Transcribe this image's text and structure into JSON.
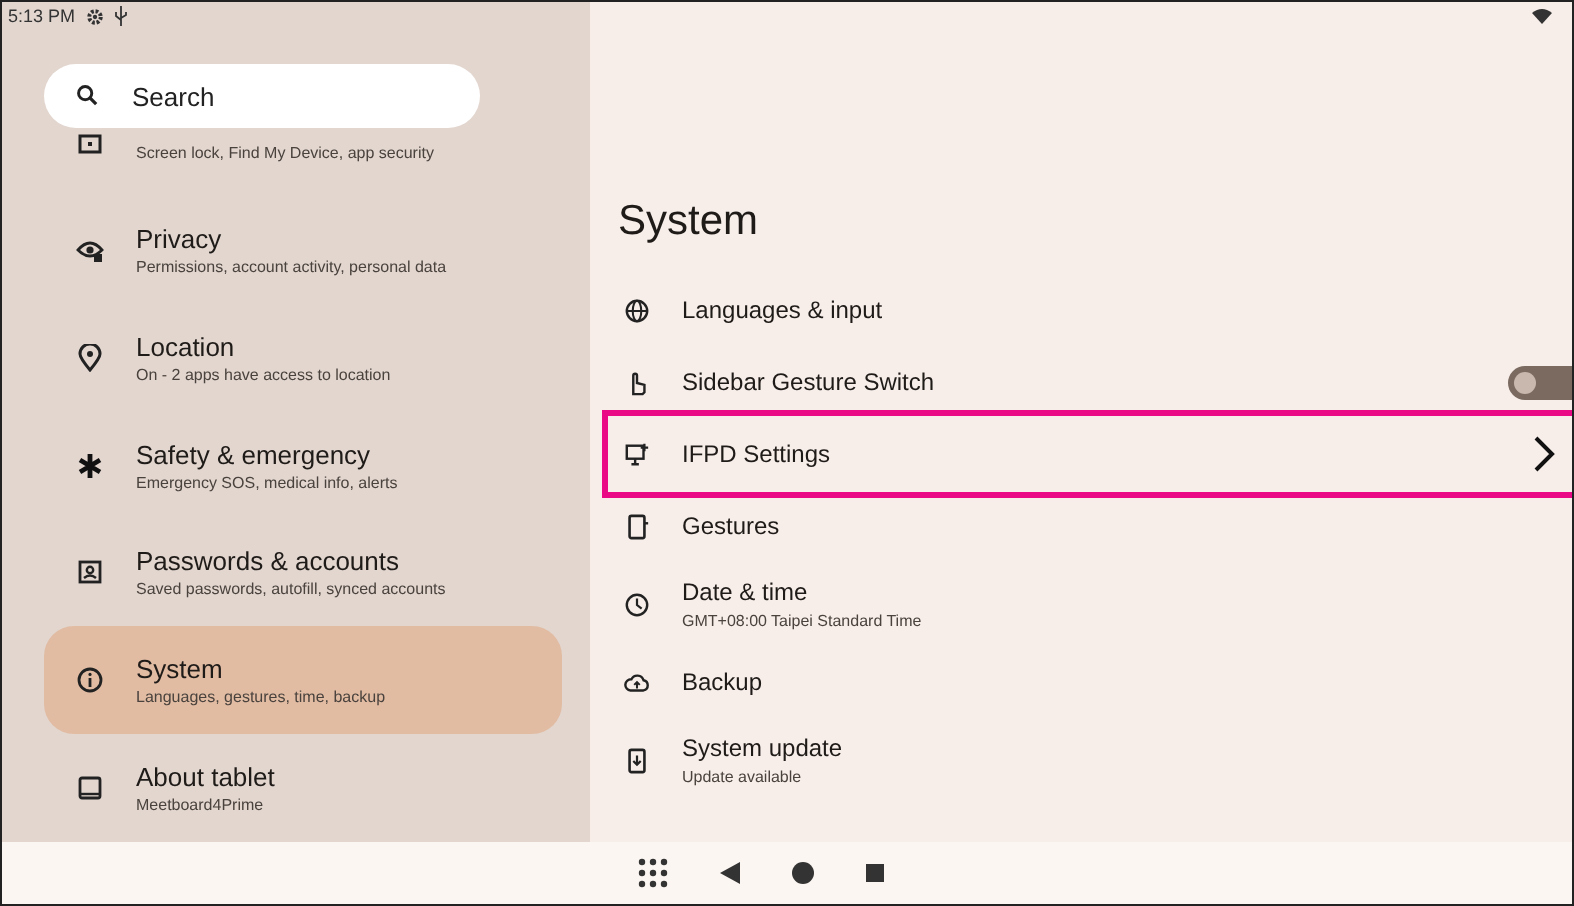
{
  "status_bar": {
    "time": "5:13 PM"
  },
  "search": {
    "placeholder": "Search"
  },
  "sidebar": {
    "items": [
      {
        "subtitle": "Screen lock, Find My Device, app security",
        "selected": false
      },
      {
        "title": "Privacy",
        "subtitle": "Permissions, account activity, personal data",
        "selected": false
      },
      {
        "title": "Location",
        "subtitle": "On - 2 apps have access to location",
        "selected": false
      },
      {
        "title": "Safety & emergency",
        "subtitle": "Emergency SOS, medical info, alerts",
        "selected": false
      },
      {
        "title": "Passwords & accounts",
        "subtitle": "Saved passwords, autofill, synced accounts",
        "selected": false
      },
      {
        "title": "System",
        "subtitle": "Languages, gestures, time, backup",
        "selected": true
      },
      {
        "title": "About tablet",
        "subtitle": "Meetboard4Prime",
        "selected": false
      }
    ]
  },
  "page": {
    "title": "System",
    "items": [
      {
        "kind": "plain",
        "title": "Languages & input",
        "highlighted": false
      },
      {
        "kind": "toggle",
        "title": "Sidebar Gesture Switch",
        "on": false,
        "highlighted": false
      },
      {
        "kind": "chevron",
        "title": "IFPD Settings",
        "highlighted": true
      },
      {
        "kind": "plain",
        "title": "Gestures",
        "highlighted": false
      },
      {
        "kind": "plain",
        "title": "Date & time",
        "subtitle": "GMT+08:00 Taipei Standard Time",
        "highlighted": false
      },
      {
        "kind": "plain",
        "title": "Backup",
        "highlighted": false
      },
      {
        "kind": "plain",
        "title": "System update",
        "subtitle": "Update available",
        "highlighted": false
      }
    ]
  }
}
